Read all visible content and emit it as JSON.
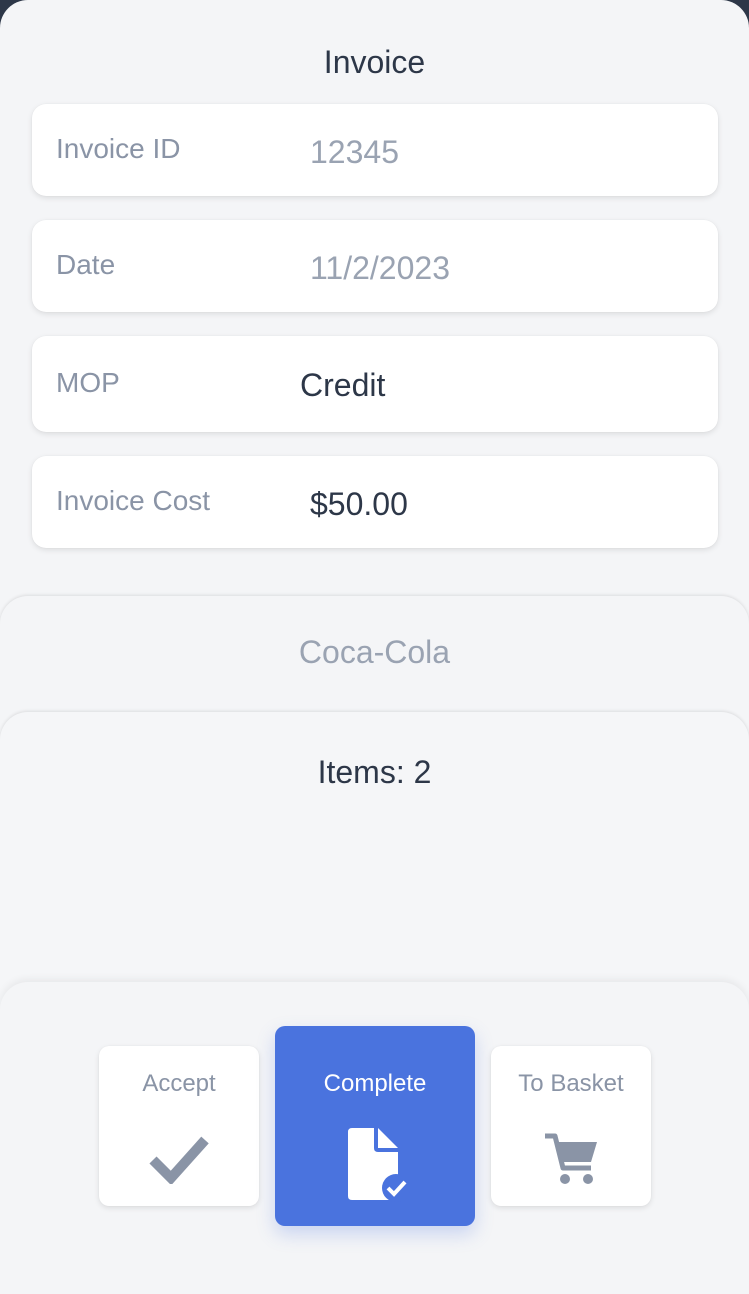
{
  "header": {
    "title": "Invoice"
  },
  "fields": [
    {
      "label": "Invoice ID",
      "value": "12345"
    },
    {
      "label": "Date",
      "value": "11/2/2023"
    },
    {
      "label": "MOP",
      "value": "Credit"
    },
    {
      "label": "Invoice Cost",
      "value": "$50.00"
    }
  ],
  "vendor": {
    "name": "Coca-Cola"
  },
  "items": {
    "summary": "Items: 2"
  },
  "actions": {
    "accept_label": "Accept",
    "complete_label": "Complete",
    "basket_label": "To Basket",
    "accept_icon": "checkmark-icon",
    "complete_icon": "document-check-icon",
    "basket_icon": "shopping-cart-icon"
  },
  "colors": {
    "primary": "#4a73de",
    "text_dark": "#2d3748",
    "text_muted": "#9aa3b2",
    "background": "#f4f5f7"
  }
}
